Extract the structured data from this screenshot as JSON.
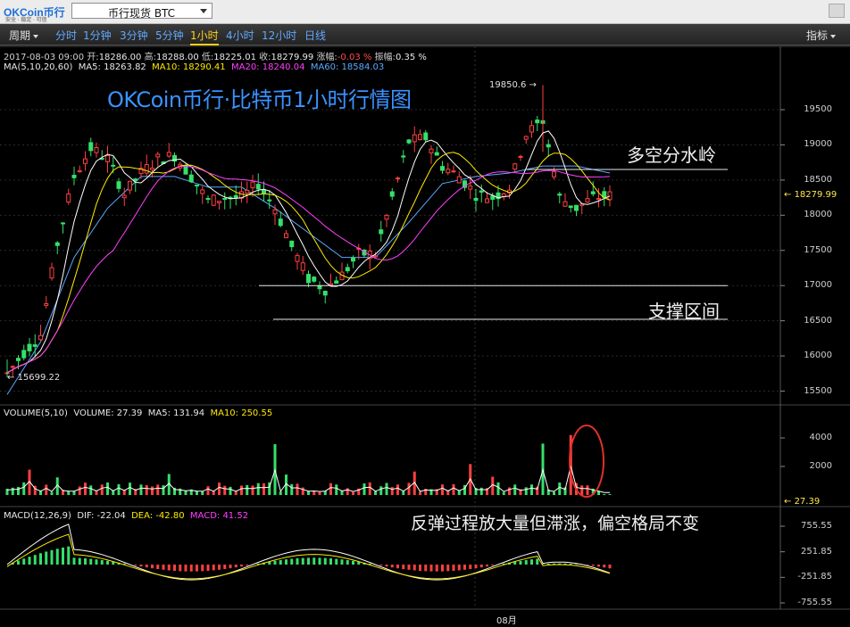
{
  "app": {
    "logo": "OKCoin币行",
    "logo_sub": "安全 · 稳定 · 可信",
    "symbol_select": "币行现货 BTC"
  },
  "toolbar": {
    "period_label": "周期",
    "intervals": [
      "分时",
      "1分钟",
      "3分钟",
      "5分钟",
      "1小时",
      "4小时",
      "12小时",
      "日线"
    ],
    "active_interval": "1小时",
    "indicator_label": "指标"
  },
  "ohlc": {
    "date": "2017-08-03 09:00",
    "open_label": "开:",
    "open": "18286.00",
    "high_label": "高:",
    "high": "18288.00",
    "low_label": "低:",
    "low": "18225.01",
    "close_label": "收:",
    "close": "18279.99",
    "change_label": "涨幅:",
    "change": "-0.03 %",
    "amplitude_label": "振幅:",
    "amplitude": "0.35 %"
  },
  "ma_row": {
    "label": "MA(5,10,20,60)",
    "ma5": "MA5: 18263.82",
    "ma10": "MA10: 18290.41",
    "ma20": "MA20: 18240.04",
    "ma60": "MA60: 18584.03"
  },
  "main": {
    "title": "OKCoin币行·比特币1小时行情图",
    "annotation_resistance": "多空分水岭",
    "annotation_support": "支撑区间",
    "annotation_macd": "反弹过程放大量但滞涨，偏空格局不变",
    "high_marker": "19850.6",
    "low_marker": "15699.22",
    "last_price": "18279.99"
  },
  "volume_row": {
    "label": "VOLUME(5,10)",
    "volume": "VOLUME: 27.39",
    "ma5": "MA5: 131.94",
    "ma10": "MA10: 250.55",
    "last": "27.39"
  },
  "macd_row": {
    "label": "MACD(12,26,9)",
    "dif": "DIF: -22.04",
    "dea": "DEA: -42.80",
    "macd": "MACD: 41.52"
  },
  "x_axis": {
    "month_label": "08月"
  },
  "chart_data": {
    "type": "candlestick",
    "price_axis_ticks": [
      19500,
      19000,
      18500,
      18000,
      17500,
      17000,
      16500,
      16000,
      15500
    ],
    "volume_axis_ticks": [
      4000,
      2000
    ],
    "macd_axis_ticks": [
      755.55,
      251.85,
      -251.85,
      -755.55
    ],
    "resistance_level": 18650,
    "support_levels": [
      17000,
      16520
    ],
    "key_points": {
      "x": [
        0,
        96
      ],
      "price": [
        15699.22,
        19850.6
      ]
    },
    "price_path": [
      [
        0,
        15750
      ],
      [
        3,
        16050
      ],
      [
        6,
        16300
      ],
      [
        9,
        17600
      ],
      [
        12,
        18550
      ],
      [
        15,
        18950
      ],
      [
        18,
        18800
      ],
      [
        21,
        18300
      ],
      [
        24,
        18600
      ],
      [
        27,
        18800
      ],
      [
        30,
        18850
      ],
      [
        33,
        18550
      ],
      [
        36,
        18200
      ],
      [
        39,
        18250
      ],
      [
        42,
        18250
      ],
      [
        45,
        18450
      ],
      [
        48,
        18100
      ],
      [
        51,
        17550
      ],
      [
        54,
        17100
      ],
      [
        57,
        16950
      ],
      [
        60,
        17150
      ],
      [
        63,
        17450
      ],
      [
        66,
        17450
      ],
      [
        69,
        18250
      ],
      [
        72,
        19050
      ],
      [
        75,
        19100
      ],
      [
        78,
        18700
      ],
      [
        81,
        18550
      ],
      [
        84,
        18300
      ],
      [
        87,
        18250
      ],
      [
        90,
        18400
      ],
      [
        93,
        19150
      ],
      [
        96,
        19350
      ],
      [
        99,
        18250
      ],
      [
        102,
        18100
      ],
      [
        105,
        18250
      ],
      [
        108,
        18280
      ]
    ],
    "ma60_path": [
      [
        0,
        15450
      ],
      [
        6,
        16200
      ],
      [
        12,
        17400
      ],
      [
        18,
        18100
      ],
      [
        24,
        18550
      ],
      [
        30,
        18550
      ],
      [
        36,
        18400
      ],
      [
        42,
        18400
      ],
      [
        48,
        18100
      ],
      [
        54,
        17750
      ],
      [
        60,
        17400
      ],
      [
        66,
        17400
      ],
      [
        72,
        17900
      ],
      [
        78,
        18450
      ],
      [
        84,
        18550
      ],
      [
        90,
        18600
      ],
      [
        96,
        18700
      ],
      [
        102,
        18700
      ],
      [
        108,
        18600
      ]
    ]
  }
}
